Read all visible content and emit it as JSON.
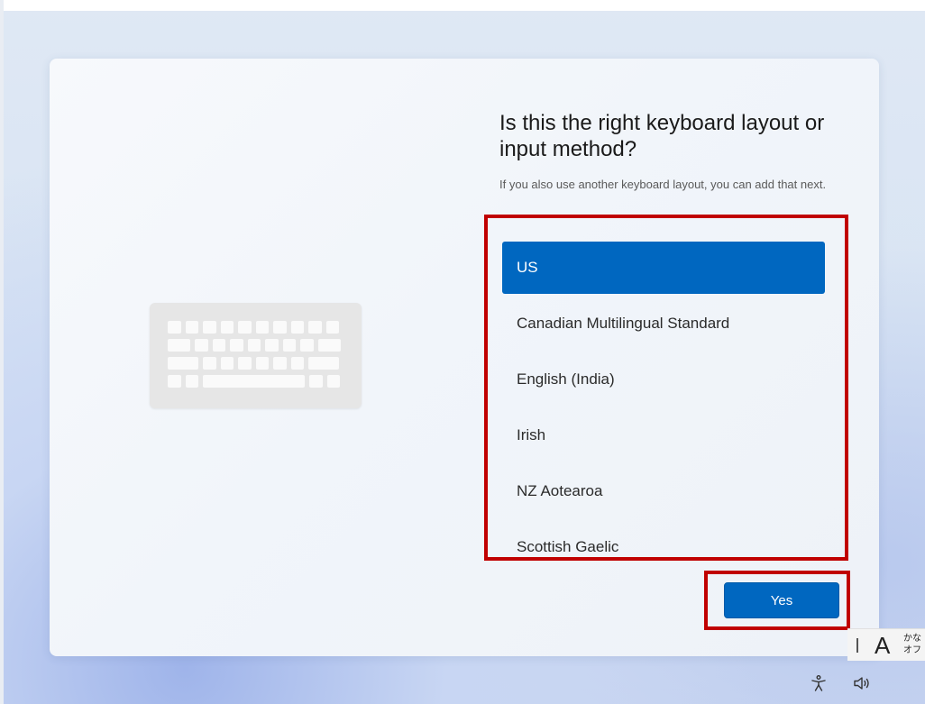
{
  "oobe": {
    "title": "Is this the right keyboard layout or input method?",
    "subtitle": "If you also use another keyboard layout, you can add that next.",
    "layouts": [
      {
        "label": "US",
        "selected": true
      },
      {
        "label": "Canadian Multilingual Standard",
        "selected": false
      },
      {
        "label": "English (India)",
        "selected": false
      },
      {
        "label": "Irish",
        "selected": false
      },
      {
        "label": "NZ Aotearoa",
        "selected": false
      },
      {
        "label": "Scottish Gaelic",
        "selected": false
      }
    ],
    "yes_label": "Yes"
  },
  "ime": {
    "mode": "A",
    "kana_line1": "かな",
    "kana_line2": "オフ"
  },
  "tray": {
    "accessibility_icon": "accessibility-icon",
    "volume_icon": "volume-icon"
  },
  "colors": {
    "accent": "#0067c0",
    "highlight_frame": "#c00000"
  }
}
